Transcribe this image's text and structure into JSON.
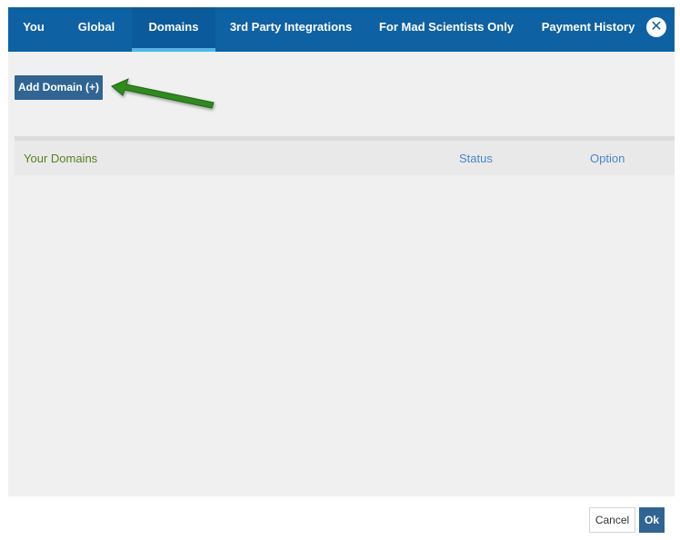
{
  "tabs": [
    {
      "label": "You"
    },
    {
      "label": "Global"
    },
    {
      "label": "Domains",
      "active": true
    },
    {
      "label": "3rd Party Integrations"
    },
    {
      "label": "For Mad Scientists Only"
    },
    {
      "label": "Payment History"
    }
  ],
  "close_icon": {
    "icon": "close-icon",
    "glyph": "✕"
  },
  "add_domain_label": "Add Domain (+)",
  "arrow_color": "#2e8b1e",
  "table": {
    "headers": {
      "domains": "Your Domains",
      "status": "Status",
      "option": "Option"
    },
    "rows": []
  },
  "footer": {
    "cancel_label": "Cancel",
    "ok_label": "Ok"
  },
  "colors": {
    "header_bg": "#0e61a3",
    "active_tab_underline": "#4fb8ea",
    "button_primary": "#2f6493"
  }
}
